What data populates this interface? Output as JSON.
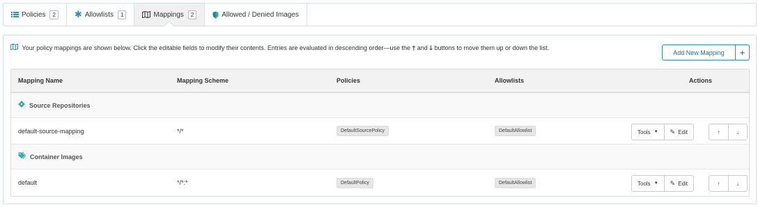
{
  "tabs": [
    {
      "label": "Policies",
      "count": "2",
      "icon": "list-icon"
    },
    {
      "label": "Allowlists",
      "count": "1",
      "icon": "asterisk-icon"
    },
    {
      "label": "Mappings",
      "count": "2",
      "icon": "map-icon",
      "active": true
    },
    {
      "label": "Allowed / Denied Images",
      "icon": "shield-icon"
    }
  ],
  "intro": {
    "text_before": "Your policy mappings are shown below. Click the editable fields to modify their contents. Entries are evaluated in descending order—use the",
    "up_glyph": "🡑",
    "and_text": "and",
    "down_glyph": "🡓",
    "text_after": "buttons to move them up or down the list."
  },
  "add_button": {
    "label": "Add New Mapping",
    "plus": "+"
  },
  "table": {
    "headers": {
      "name": "Mapping Name",
      "scheme": "Mapping Scheme",
      "policies": "Policies",
      "allowlists": "Allowlists",
      "actions": "Actions"
    },
    "groups": [
      {
        "label": "Source Repositories",
        "icon": "git-icon",
        "rows": [
          {
            "name": "default-source-mapping",
            "scheme": "*/*",
            "policy": "DefaultSourcePolicy",
            "allowlist": "DefaultAllowlist"
          }
        ]
      },
      {
        "label": "Container Images",
        "icon": "tags-icon",
        "rows": [
          {
            "name": "default",
            "scheme": "*/*:*",
            "policy": "DefaultPolicy",
            "allowlist": "DefaultAllowlist"
          }
        ]
      }
    ],
    "actions": {
      "tools": "Tools",
      "edit": "Edit",
      "up": "↑",
      "down": "↓"
    }
  },
  "colors": {
    "accent": "#2b8fbf",
    "group_icon": "#2bb0a5",
    "border": "#cfe3ea"
  }
}
